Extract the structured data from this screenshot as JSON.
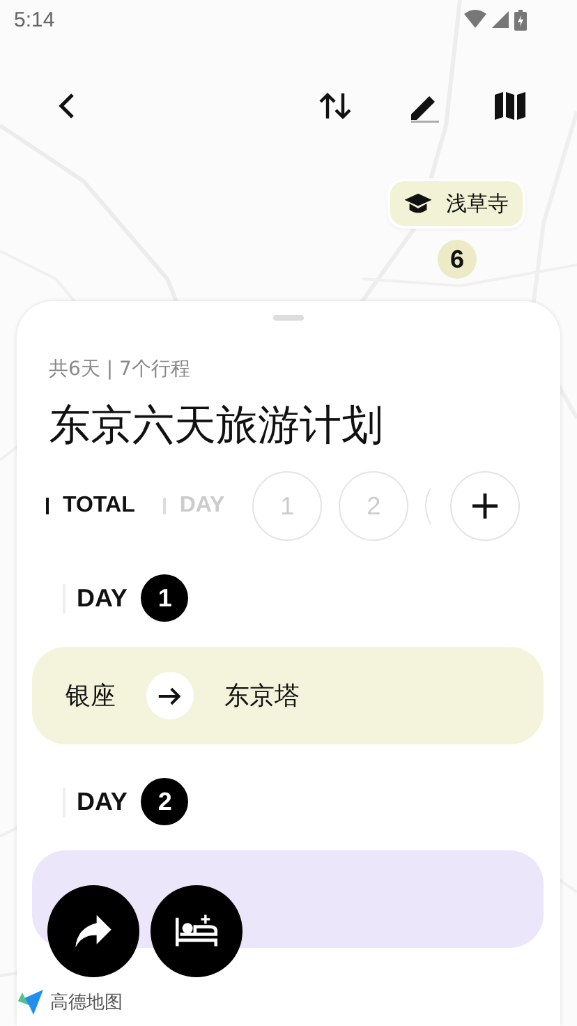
{
  "status_bar": {
    "time": "5:14"
  },
  "map": {
    "kind": "picture",
    "pin": {
      "label": "浅草寺",
      "count": "6"
    },
    "attribution": "高德地图"
  },
  "plan": {
    "meta": "共6天 | 7个行程",
    "title": "东京六天旅游计划"
  },
  "tabs": [
    {
      "label": "TOTAL",
      "selected": true
    },
    {
      "label": "DAY",
      "selected": false
    }
  ],
  "day_chips": [
    {
      "kind": "full",
      "label": "1"
    },
    {
      "kind": "full",
      "label": "2"
    },
    {
      "kind": "partial"
    }
  ],
  "days": [
    {
      "label": "DAY",
      "number": "1",
      "color": "#f4f4dc",
      "route": {
        "from": "银座",
        "to": "东京塔"
      }
    },
    {
      "label": "DAY",
      "number": "2",
      "color": "#ece6fa"
    }
  ]
}
